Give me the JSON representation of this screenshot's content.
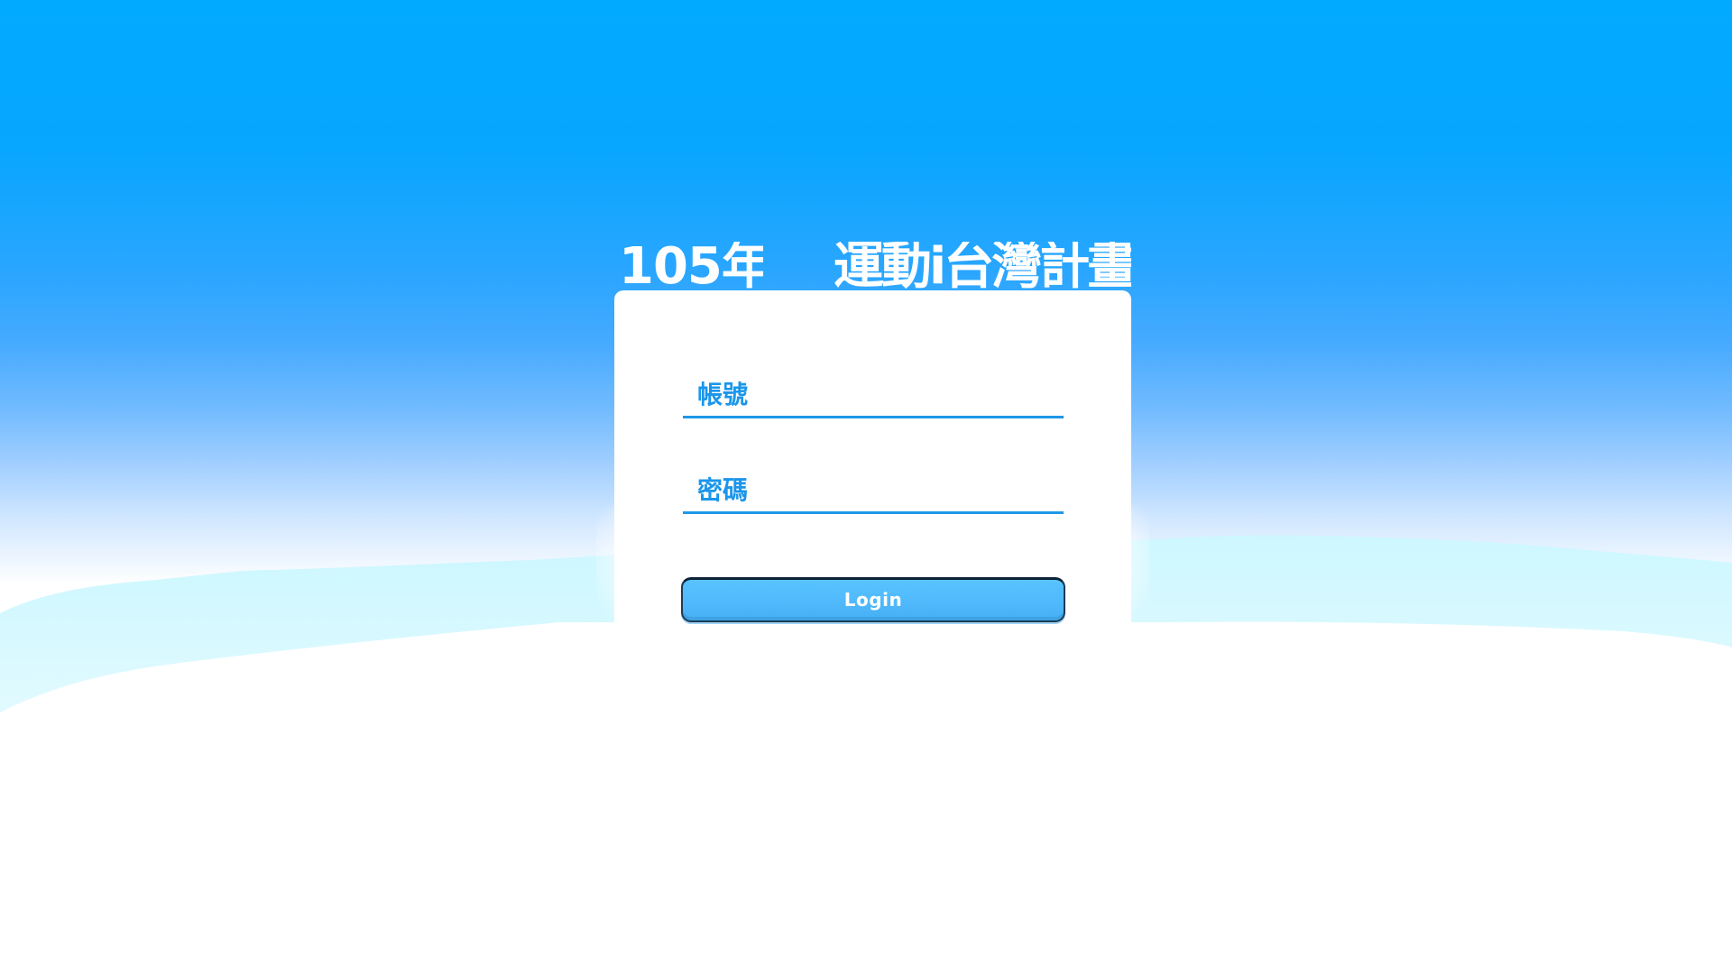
{
  "header": {
    "year": "105年",
    "title": "運動i台灣計畫"
  },
  "login_form": {
    "username": {
      "placeholder": "帳號",
      "value": ""
    },
    "password": {
      "placeholder": "密碼",
      "value": ""
    },
    "submit_label": "Login"
  },
  "colors": {
    "sky_top": "#02aaff",
    "accent": "#1e98e8",
    "button": "#4fb8fb",
    "card": "#ffffff"
  }
}
